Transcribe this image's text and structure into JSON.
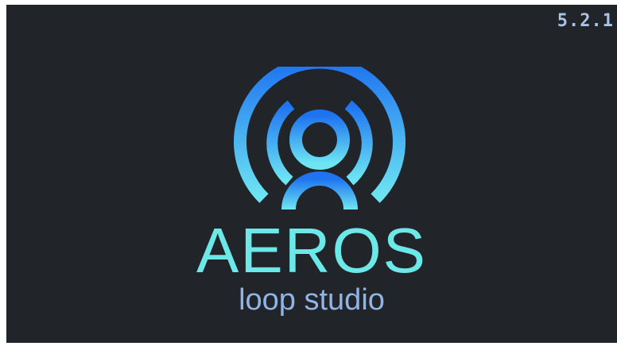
{
  "splash": {
    "version": "5.2.1",
    "brand_name": "AEROS",
    "tagline": "loop studio"
  },
  "colors": {
    "background": "#212428",
    "logo_top": "#1e73f0",
    "logo_bottom": "#6ee6f2",
    "brand_name": "#6ce8e8",
    "tagline": "#8fb4e6",
    "version": "#a8c4e8"
  },
  "icons": {
    "logo": "aeros-logo-icon"
  }
}
